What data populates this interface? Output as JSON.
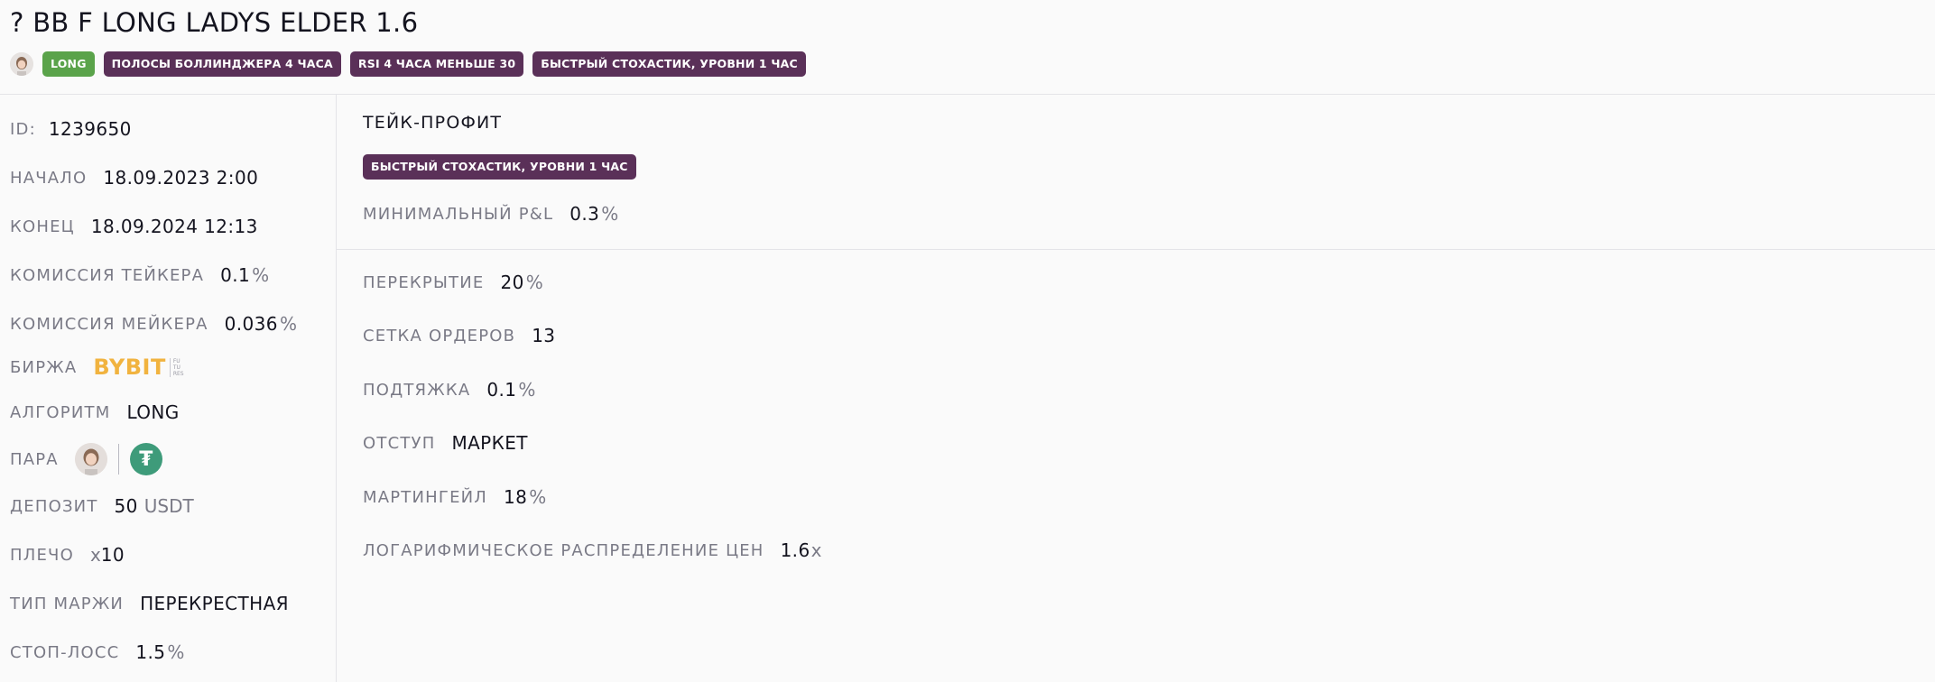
{
  "header": {
    "title": "? BB F LONG LADYS ELDER 1.6",
    "tags": [
      {
        "label": "LONG",
        "color": "#5aa34a"
      },
      {
        "label": "ПОЛОСЫ БОЛЛИНДЖЕРА 4 ЧАСА",
        "color": "#5a3058"
      },
      {
        "label": "RSI 4 ЧАСА МЕНЬШЕ 30",
        "color": "#5a3058"
      },
      {
        "label": "БЫСТРЫЙ СТОХАСТИК, УРОВНИ 1 ЧАС",
        "color": "#5a3058"
      }
    ]
  },
  "left": {
    "id_label": "ID:",
    "id_value": "1239650",
    "start_label": "НАЧАЛО",
    "start_value": "18.09.2023 2:00",
    "end_label": "КОНЕЦ",
    "end_value": "18.09.2024 12:13",
    "taker_label": "КОМИССИЯ ТЕЙКЕРА",
    "taker_value": "0.1",
    "taker_unit": "%",
    "maker_label": "КОМИССИЯ МЕЙКЕРА",
    "maker_value": "0.036",
    "maker_unit": "%",
    "exchange_label": "БИРЖА",
    "exchange_logo_text": "BYBIT",
    "exchange_logo_sub": "FU TU RES",
    "algo_label": "АЛГОРИТМ",
    "algo_value": "LONG",
    "pair_label": "ПАРА",
    "pair_quote_symbol": "₮",
    "deposit_label": "ДЕПОЗИТ",
    "deposit_value": "50",
    "deposit_unit": "USDT",
    "leverage_label": "ПЛЕЧО",
    "leverage_prefix": "x",
    "leverage_value": "10",
    "margin_label": "ТИП МАРЖИ",
    "margin_value": "ПЕРЕКРЕСТНАЯ",
    "stoploss_label": "СТОП-ЛОСС",
    "stoploss_value": "1.5",
    "stoploss_unit": "%"
  },
  "take_profit": {
    "title": "ТЕЙК-ПРОФИТ",
    "tag": "БЫСТРЫЙ СТОХАСТИК, УРОВНИ 1 ЧАС",
    "min_pnl_label": "МИНИМАЛЬНЫЙ P&L",
    "min_pnl_value": "0.3",
    "min_pnl_unit": "%"
  },
  "grid": {
    "overlap_label": "ПЕРЕКРЫТИЕ",
    "overlap_value": "20",
    "overlap_unit": "%",
    "orders_label": "СЕТКА ОРДЕРОВ",
    "orders_value": "13",
    "pullup_label": "ПОДТЯЖКА",
    "pullup_value": "0.1",
    "pullup_unit": "%",
    "indent_label": "ОТСТУП",
    "indent_value": "МАРКЕТ",
    "martingale_label": "МАРТИНГЕЙЛ",
    "martingale_value": "18",
    "martingale_unit": "%",
    "log_label": "ЛОГАРИФМИЧЕСКОЕ РАСПРЕДЕЛЕНИЕ ЦЕН",
    "log_value": "1.6",
    "log_unit": "x"
  }
}
